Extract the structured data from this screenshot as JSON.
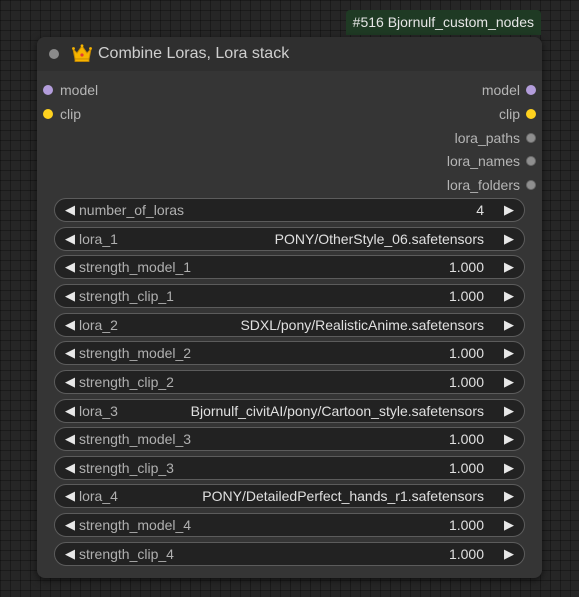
{
  "badge": "#516 Bjornulf_custom_nodes",
  "node": {
    "title": "Combine Loras, Lora stack",
    "title_icon": "crown-icon",
    "colors": {
      "model": "#b39ddb",
      "clip": "#ffd21f",
      "string": "#8f8f8f",
      "badge_bg": "#1f3a24"
    },
    "inputs": [
      {
        "label": "model",
        "type": "model"
      },
      {
        "label": "clip",
        "type": "clip"
      }
    ],
    "outputs": [
      {
        "label": "model",
        "type": "model"
      },
      {
        "label": "clip",
        "type": "clip"
      },
      {
        "label": "lora_paths",
        "type": "string"
      },
      {
        "label": "lora_names",
        "type": "string"
      },
      {
        "label": "lora_folders",
        "type": "string"
      }
    ],
    "widgets": [
      {
        "name": "number_of_loras",
        "value": "4"
      },
      {
        "name": "lora_1",
        "value": "PONY/OtherStyle_06.safetensors"
      },
      {
        "name": "strength_model_1",
        "value": "1.000"
      },
      {
        "name": "strength_clip_1",
        "value": "1.000"
      },
      {
        "name": "lora_2",
        "value": "SDXL/pony/RealisticAnime.safetensors"
      },
      {
        "name": "strength_model_2",
        "value": "1.000"
      },
      {
        "name": "strength_clip_2",
        "value": "1.000"
      },
      {
        "name": "lora_3",
        "value": "Bjornulf_civitAI/pony/Cartoon_style.safetensors"
      },
      {
        "name": "strength_model_3",
        "value": "1.000"
      },
      {
        "name": "strength_clip_3",
        "value": "1.000"
      },
      {
        "name": "lora_4",
        "value": "PONY/DetailedPerfect_hands_r1.safetensors"
      },
      {
        "name": "strength_model_4",
        "value": "1.000"
      },
      {
        "name": "strength_clip_4",
        "value": "1.000"
      }
    ]
  }
}
